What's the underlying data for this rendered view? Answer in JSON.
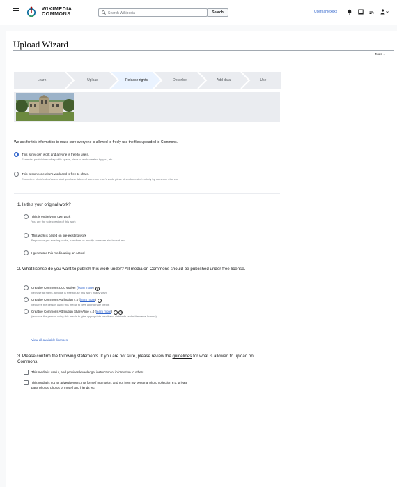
{
  "header": {
    "wordmark_line1": "WIKIMEDIA",
    "wordmark_line2": "COMMONS",
    "search_placeholder": "Search Wikipedia",
    "search_button": "Search",
    "username": "Usernamexxxx"
  },
  "page": {
    "title": "Upload Wizard",
    "tools_label": "Tools"
  },
  "steps": [
    "Learn",
    "Upload",
    "Release rights",
    "Describe",
    "Add data",
    "Use"
  ],
  "active_step": "Release rights",
  "intro": "We ask for this information to make sure everyone is allowed to freely use the files uploaded to Commons.",
  "ownership": {
    "own": {
      "label": "This is my own work and anyone is free to use it.",
      "example": "Example: photo/video of a public space, piece of work created by you, etc."
    },
    "other": {
      "label": "This is someone else's work and is free to share.",
      "example": "Examples: photo/video/screenshot you have taken of someone else's work, piece of work created entirely by someone else etc."
    }
  },
  "q1": {
    "title": "1. Is this your original work?",
    "options": [
      {
        "label": "This is entirely my own work",
        "sub": "You are the sole creator of this work"
      },
      {
        "label": "This work is based on pre-existing work",
        "sub": "Reproduce pre-existing works, transform or modify someone else's work etc."
      },
      {
        "label": "I generated this media using an AI tool",
        "sub": ""
      }
    ]
  },
  "q2": {
    "title": "2. What license do you want to publish this work under? All media on Commons should be published under free license.",
    "learn_more": "learn more",
    "options": [
      {
        "label": "Creative Commons CC0 Waiver",
        "sub": "(release all rights, anyone is free to use this work in any way)"
      },
      {
        "label": "Creative Commons Attribution 4.0",
        "sub": "(requires the person using this media to give appropriate credit)"
      },
      {
        "label": "Creative Commons Attribution ShareAlike 4.0",
        "sub": "(requires the person using this media to give appropriate credit and distribute under the same license)"
      }
    ],
    "view_all": "View all available licenses"
  },
  "q3": {
    "title_before": "3. Please confirm the following statements. If you are not sure, please review the ",
    "title_link": "guidelines",
    "title_after": " for what is allowed to upload on Commons.",
    "checks": [
      "This media is useful, and provides knowledge, instruction or information to others.",
      "This media is not an advertisement, not for self promotion, and not from my personal photo collection e.g. private",
      "party photos, photos of myself and friends etc."
    ]
  },
  "colors": {
    "accent": "#3366cc",
    "step_bg": "#eaecf0",
    "step_active": "#eaf3ff"
  }
}
